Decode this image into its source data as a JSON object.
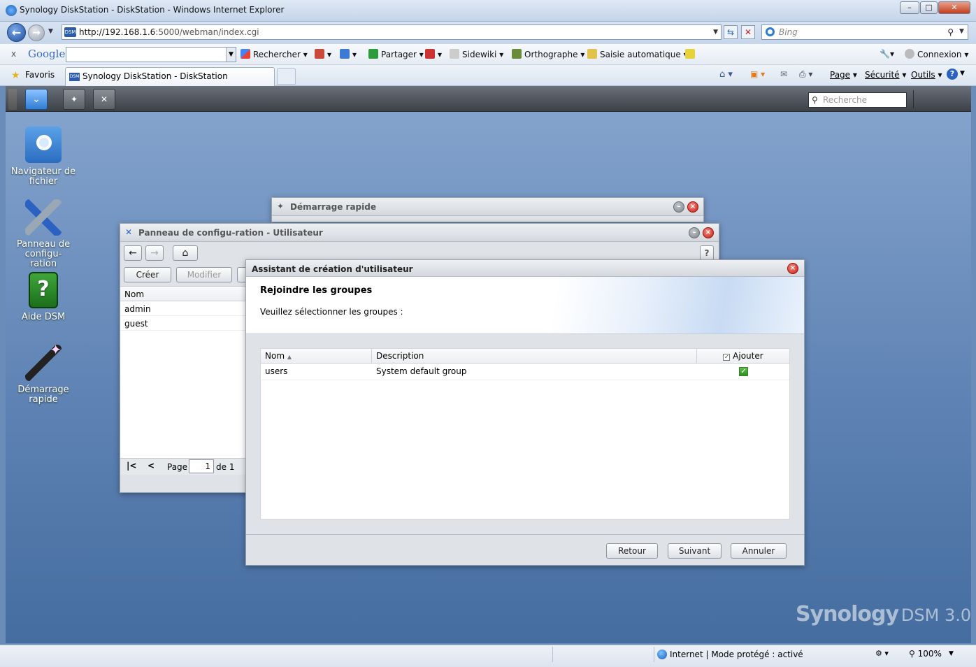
{
  "browser": {
    "window_title": "Synology DiskStation - DiskStation - Windows Internet Explorer",
    "url_host": "http://192.168.1.6",
    "url_path": ":5000/webman/index.cgi",
    "url_badge": "DSM",
    "search_provider": "Bing",
    "google_toolbar": {
      "close": "x",
      "logo": "Google",
      "search": "Rechercher",
      "share": "Partager",
      "sidewiki": "Sidewiki",
      "spelling": "Orthographe",
      "autofill": "Saisie automatique",
      "connect": "Connexion"
    },
    "favorites": "Favoris",
    "tab_title": "Synology DiskStation - DiskStation",
    "command_bar": {
      "page": "Page",
      "safety": "Sécurité",
      "tools": "Outils"
    },
    "status": {
      "zone": "Internet | Mode protégé : activé",
      "zoom": "100%"
    }
  },
  "dsm": {
    "search_placeholder": "Recherche",
    "brand": "Synology",
    "version": "DSM 3.0",
    "desktop_icons": [
      {
        "label": "Navigateur de fichier",
        "icon": "file-browser-icon"
      },
      {
        "label": "Panneau de configu-ration",
        "icon": "control-panel-icon"
      },
      {
        "label": "Aide DSM",
        "icon": "help-icon"
      },
      {
        "label": "Démarrage rapide",
        "icon": "quick-start-icon"
      }
    ],
    "quickstart_window": {
      "title": "Démarrage rapide"
    },
    "control_panel": {
      "title": "Panneau de configu-ration - Utilisateur",
      "create": "Créer",
      "modify": "Modifier",
      "column_name": "Nom",
      "users": [
        "admin",
        "guest"
      ],
      "pager": {
        "page_label": "Page",
        "page_value": "1",
        "of_label": "de 1"
      }
    },
    "wizard": {
      "title": "Assistant de création d'utilisateur",
      "heading": "Rejoindre les groupes",
      "subtitle": "Veuillez sélectionner les groupes :",
      "columns": {
        "name": "Nom",
        "description": "Description",
        "add": "Ajouter"
      },
      "rows": [
        {
          "name": "users",
          "description": "System default group",
          "checked": true
        }
      ],
      "back": "Retour",
      "next": "Suivant",
      "cancel": "Annuler"
    }
  }
}
